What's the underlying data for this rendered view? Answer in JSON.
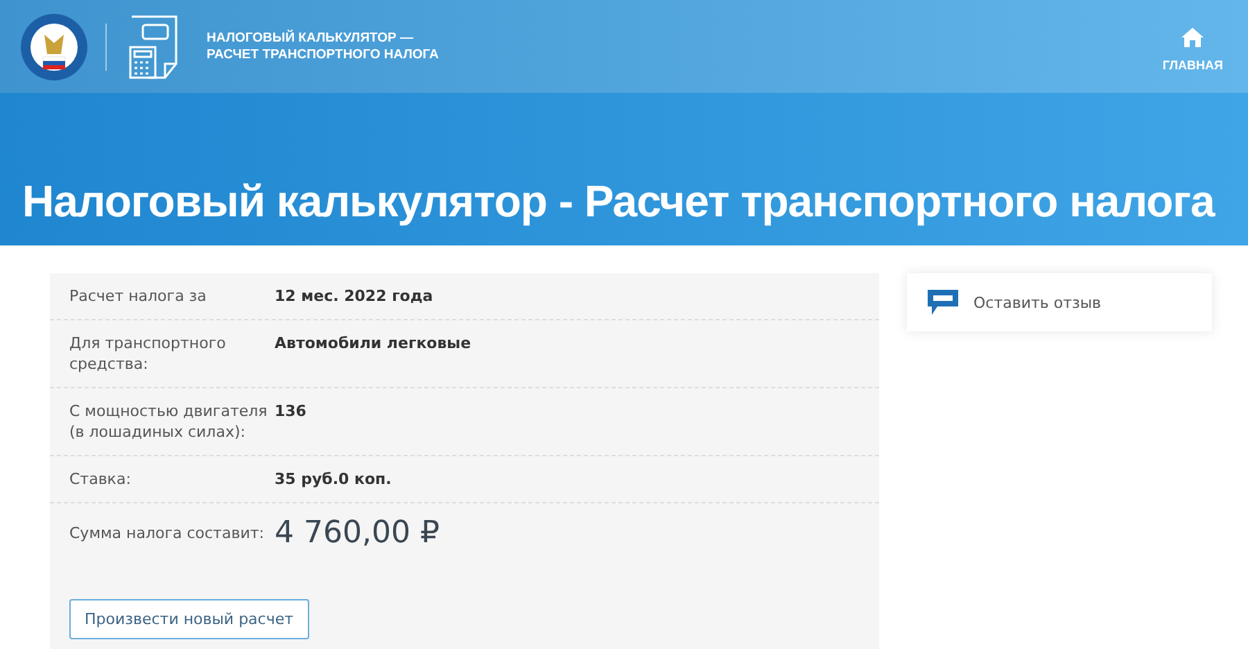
{
  "header": {
    "service_title_lines": [
      "НАЛОГОВЫЙ КАЛЬКУЛЯТОР —",
      "РАСЧЕТ ТРАНСПОРТНОГО НАЛОГА"
    ],
    "home_link": "ГЛАВНАЯ"
  },
  "page_title": "Налоговый калькулятор - Расчет транспортного налога",
  "result": {
    "rows": [
      {
        "label": "Расчет налога за",
        "value": "12 мес. 2022 года"
      },
      {
        "label": "Для транспортного средства:",
        "value": "Автомобили легковые"
      },
      {
        "label": "С мощностью двигателя (в лошадиных силах):",
        "value": "136"
      },
      {
        "label": "Ставка:",
        "value": "35 руб.0 коп."
      }
    ],
    "total_label": "Сумма налога составит:",
    "total_value": "4 760,00 ₽",
    "new_calc_button": "Произвести новый расчет"
  },
  "feedback": {
    "label": "Оставить отзыв"
  }
}
